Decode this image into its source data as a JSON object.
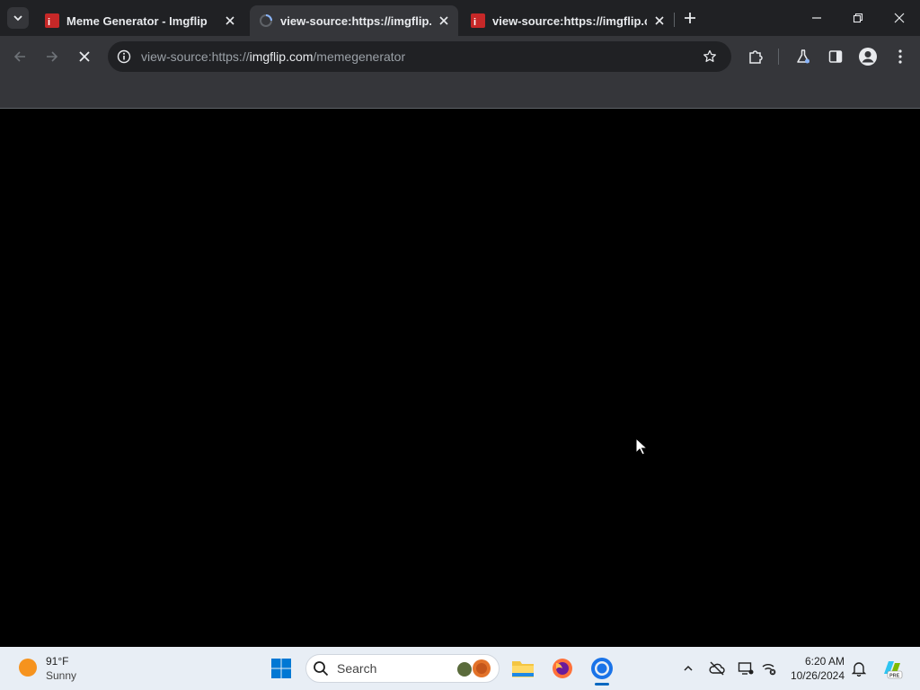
{
  "tabs": [
    {
      "title": "Meme Generator - Imgflip",
      "active": false,
      "favicon": "imgflip-favicon"
    },
    {
      "title": "view-source:https://imgflip.com",
      "active": true,
      "favicon": "loading-spinner-icon"
    },
    {
      "title": "view-source:https://imgflip.com",
      "active": false,
      "favicon": "imgflip-favicon"
    }
  ],
  "address_bar": {
    "prefix": "view-source:https://",
    "host": "imgflip.com",
    "path": "/memegenerator"
  },
  "weather": {
    "temp": "91°F",
    "desc": "Sunny"
  },
  "taskbar": {
    "search_placeholder": "Search"
  },
  "clock": {
    "time": "6:20 AM",
    "date": "10/26/2024"
  },
  "colors": {
    "accent": "#0067c0",
    "tab_bar": "#202124",
    "toolbar": "#35363a",
    "imgflip_red": "#c62828"
  }
}
